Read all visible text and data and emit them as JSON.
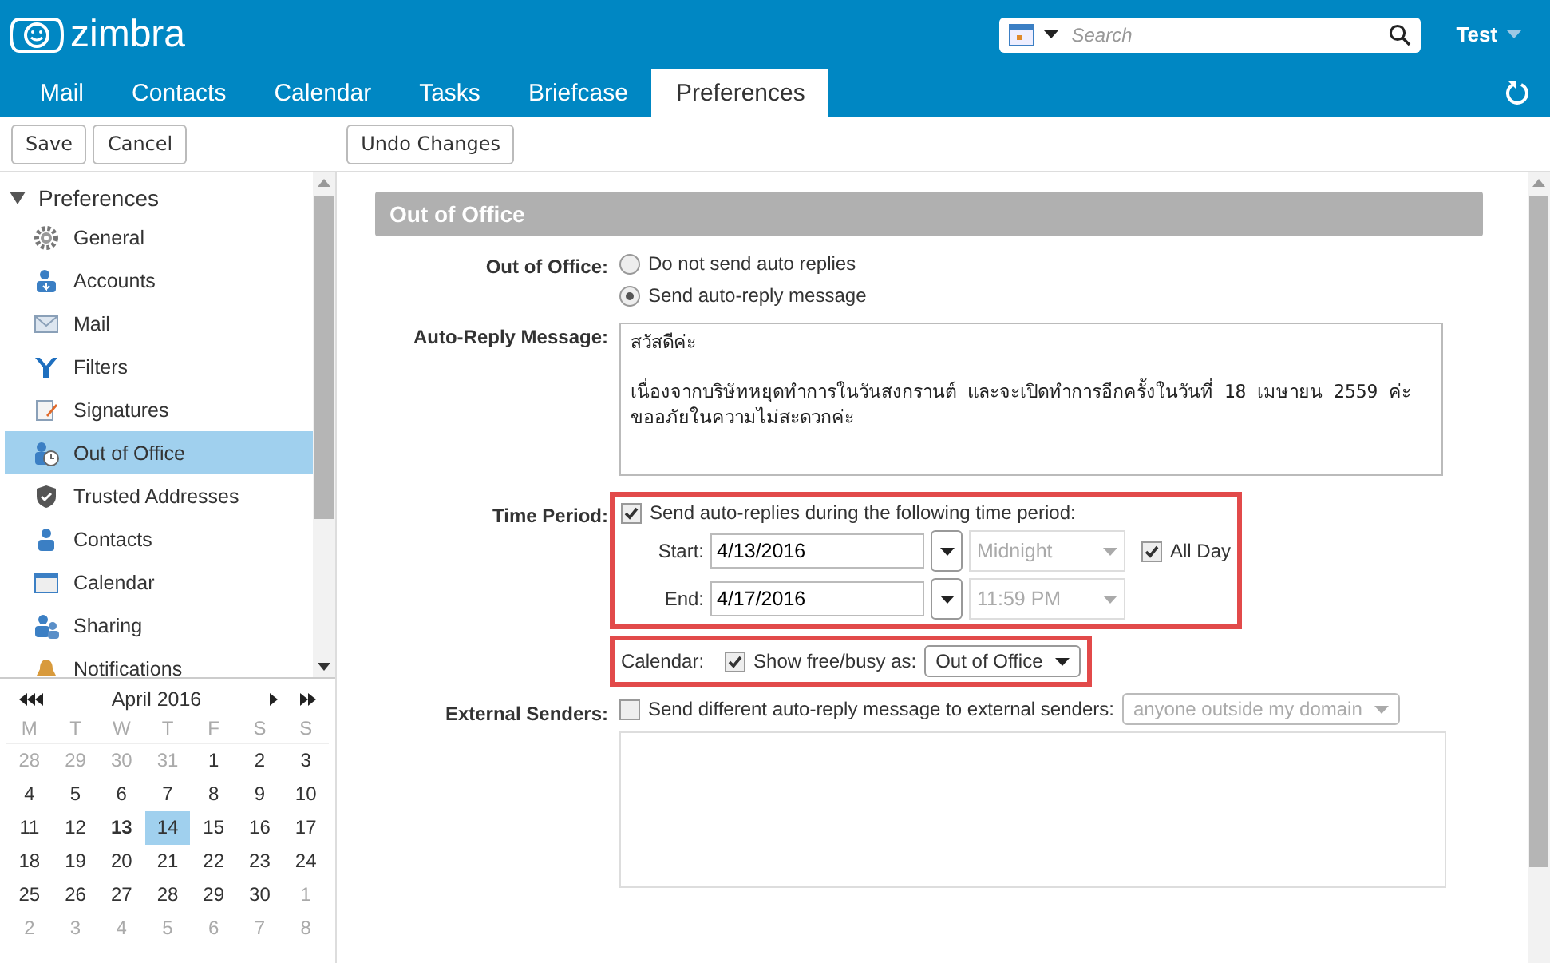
{
  "app": {
    "logo": "zimbra",
    "search": {
      "placeholder": "Search"
    },
    "user": "Test"
  },
  "tabs": [
    {
      "label": "Mail",
      "selected": false
    },
    {
      "label": "Contacts",
      "selected": false
    },
    {
      "label": "Calendar",
      "selected": false
    },
    {
      "label": "Tasks",
      "selected": false
    },
    {
      "label": "Briefcase",
      "selected": false
    },
    {
      "label": "Preferences",
      "selected": true
    }
  ],
  "toolbar": {
    "left_buttons": [
      "Save",
      "Cancel"
    ],
    "right_buttons": [
      "Undo Changes"
    ]
  },
  "sidebar": {
    "title": "Preferences",
    "expanded": true,
    "items": [
      {
        "label": "General",
        "selected": false
      },
      {
        "label": "Accounts",
        "selected": false
      },
      {
        "label": "Mail",
        "selected": false
      },
      {
        "label": "Filters",
        "selected": false
      },
      {
        "label": "Signatures",
        "selected": false
      },
      {
        "label": "Out of Office",
        "selected": true
      },
      {
        "label": "Trusted Addresses",
        "selected": false
      },
      {
        "label": "Contacts",
        "selected": false
      },
      {
        "label": "Calendar",
        "selected": false
      },
      {
        "label": "Sharing",
        "selected": false
      },
      {
        "label": "Notifications",
        "selected": false
      }
    ]
  },
  "mini_calendar": {
    "title": "April 2016",
    "weekdays": [
      "M",
      "T",
      "W",
      "T",
      "F",
      "S",
      "S"
    ],
    "days": [
      {
        "label": "28",
        "other_month": true,
        "today": false,
        "selected": false
      },
      {
        "label": "29",
        "other_month": true,
        "today": false,
        "selected": false
      },
      {
        "label": "30",
        "other_month": true,
        "today": false,
        "selected": false
      },
      {
        "label": "31",
        "other_month": true,
        "today": false,
        "selected": false
      },
      {
        "label": "1",
        "other_month": false,
        "today": false,
        "selected": false
      },
      {
        "label": "2",
        "other_month": false,
        "today": false,
        "selected": false
      },
      {
        "label": "3",
        "other_month": false,
        "today": false,
        "selected": false
      },
      {
        "label": "4",
        "other_month": false,
        "today": false,
        "selected": false
      },
      {
        "label": "5",
        "other_month": false,
        "today": false,
        "selected": false
      },
      {
        "label": "6",
        "other_month": false,
        "today": false,
        "selected": false
      },
      {
        "label": "7",
        "other_month": false,
        "today": false,
        "selected": false
      },
      {
        "label": "8",
        "other_month": false,
        "today": false,
        "selected": false
      },
      {
        "label": "9",
        "other_month": false,
        "today": false,
        "selected": false
      },
      {
        "label": "10",
        "other_month": false,
        "today": false,
        "selected": false
      },
      {
        "label": "11",
        "other_month": false,
        "today": false,
        "selected": false
      },
      {
        "label": "12",
        "other_month": false,
        "today": false,
        "selected": false
      },
      {
        "label": "13",
        "other_month": false,
        "today": true,
        "selected": false
      },
      {
        "label": "14",
        "other_month": false,
        "today": false,
        "selected": true
      },
      {
        "label": "15",
        "other_month": false,
        "today": false,
        "selected": false
      },
      {
        "label": "16",
        "other_month": false,
        "today": false,
        "selected": false
      },
      {
        "label": "17",
        "other_month": false,
        "today": false,
        "selected": false
      },
      {
        "label": "18",
        "other_month": false,
        "today": false,
        "selected": false
      },
      {
        "label": "19",
        "other_month": false,
        "today": false,
        "selected": false
      },
      {
        "label": "20",
        "other_month": false,
        "today": false,
        "selected": false
      },
      {
        "label": "21",
        "other_month": false,
        "today": false,
        "selected": false
      },
      {
        "label": "22",
        "other_month": false,
        "today": false,
        "selected": false
      },
      {
        "label": "23",
        "other_month": false,
        "today": false,
        "selected": false
      },
      {
        "label": "24",
        "other_month": false,
        "today": false,
        "selected": false
      },
      {
        "label": "25",
        "other_month": false,
        "today": false,
        "selected": false
      },
      {
        "label": "26",
        "other_month": false,
        "today": false,
        "selected": false
      },
      {
        "label": "27",
        "other_month": false,
        "today": false,
        "selected": false
      },
      {
        "label": "28",
        "other_month": false,
        "today": false,
        "selected": false
      },
      {
        "label": "29",
        "other_month": false,
        "today": false,
        "selected": false
      },
      {
        "label": "30",
        "other_month": false,
        "today": false,
        "selected": false
      },
      {
        "label": "1",
        "other_month": true,
        "today": false,
        "selected": false
      },
      {
        "label": "2",
        "other_month": true,
        "today": false,
        "selected": false
      },
      {
        "label": "3",
        "other_month": true,
        "today": false,
        "selected": false
      },
      {
        "label": "4",
        "other_month": true,
        "today": false,
        "selected": false
      },
      {
        "label": "5",
        "other_month": true,
        "today": false,
        "selected": false
      },
      {
        "label": "6",
        "other_month": true,
        "today": false,
        "selected": false
      },
      {
        "label": "7",
        "other_month": true,
        "today": false,
        "selected": false
      },
      {
        "label": "8",
        "other_month": true,
        "today": false,
        "selected": false
      }
    ]
  },
  "form": {
    "title": "Out of Office",
    "out_of_office": {
      "label": "Out of Office:",
      "options": [
        {
          "label": "Do not send auto replies",
          "selected": false
        },
        {
          "label": "Send auto-reply message",
          "selected": true
        }
      ]
    },
    "auto_reply": {
      "label": "Auto-Reply Message:",
      "value": "สวัสดีค่ะ\n\nเนื่องจากบริษัทหยุดทำการในวันสงกรานต์ และจะเปิดทำการอีกครั้งในวันที่ 18 เมษายน 2559 ค่ะ\nขออภัยในความไม่สะดวกค่ะ"
    },
    "time_period": {
      "label": "Time Period:",
      "highlighted": true,
      "checkbox": {
        "label": "Send auto-replies during the following time period:",
        "checked": true
      },
      "start": {
        "label": "Start:",
        "date": "4/13/2016",
        "time": "Midnight"
      },
      "end": {
        "label": "End:",
        "date": "4/17/2016",
        "time": "11:59 PM"
      },
      "all_day": {
        "label": "All Day",
        "checked": true
      }
    },
    "calendar": {
      "label": "Calendar:",
      "highlighted": true,
      "checkbox": {
        "label": "Show free/busy as:",
        "checked": true
      },
      "value": "Out of Office"
    },
    "external": {
      "label": "External Senders:",
      "checkbox": {
        "label": "Send different auto-reply message to external senders:",
        "checked": false
      },
      "scope": "anyone outside my domain"
    }
  }
}
